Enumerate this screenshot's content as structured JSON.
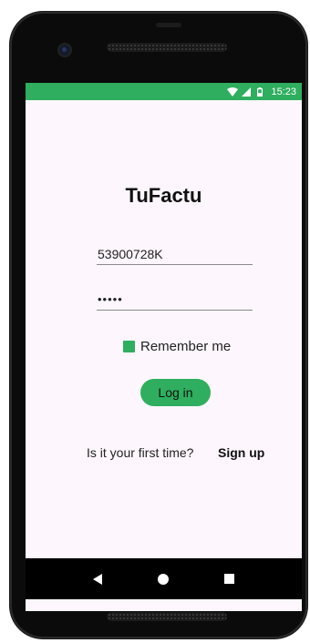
{
  "status_bar": {
    "time": "15:23",
    "icons": [
      "wifi-icon",
      "signal-icon",
      "battery-icon"
    ],
    "color": "#2eae5e"
  },
  "app": {
    "title": "TuFactu"
  },
  "form": {
    "username_value": "53900728K",
    "password_value": "•••••",
    "remember_label": "Remember me",
    "remember_checked": true,
    "login_label": "Log in",
    "first_time_text": "Is it your first time?",
    "signup_label": "Sign up"
  },
  "colors": {
    "accent": "#2eae5e",
    "background": "#fdf7fd"
  },
  "nav_bar": {
    "icons": [
      "back-icon",
      "home-icon",
      "recents-icon"
    ]
  }
}
